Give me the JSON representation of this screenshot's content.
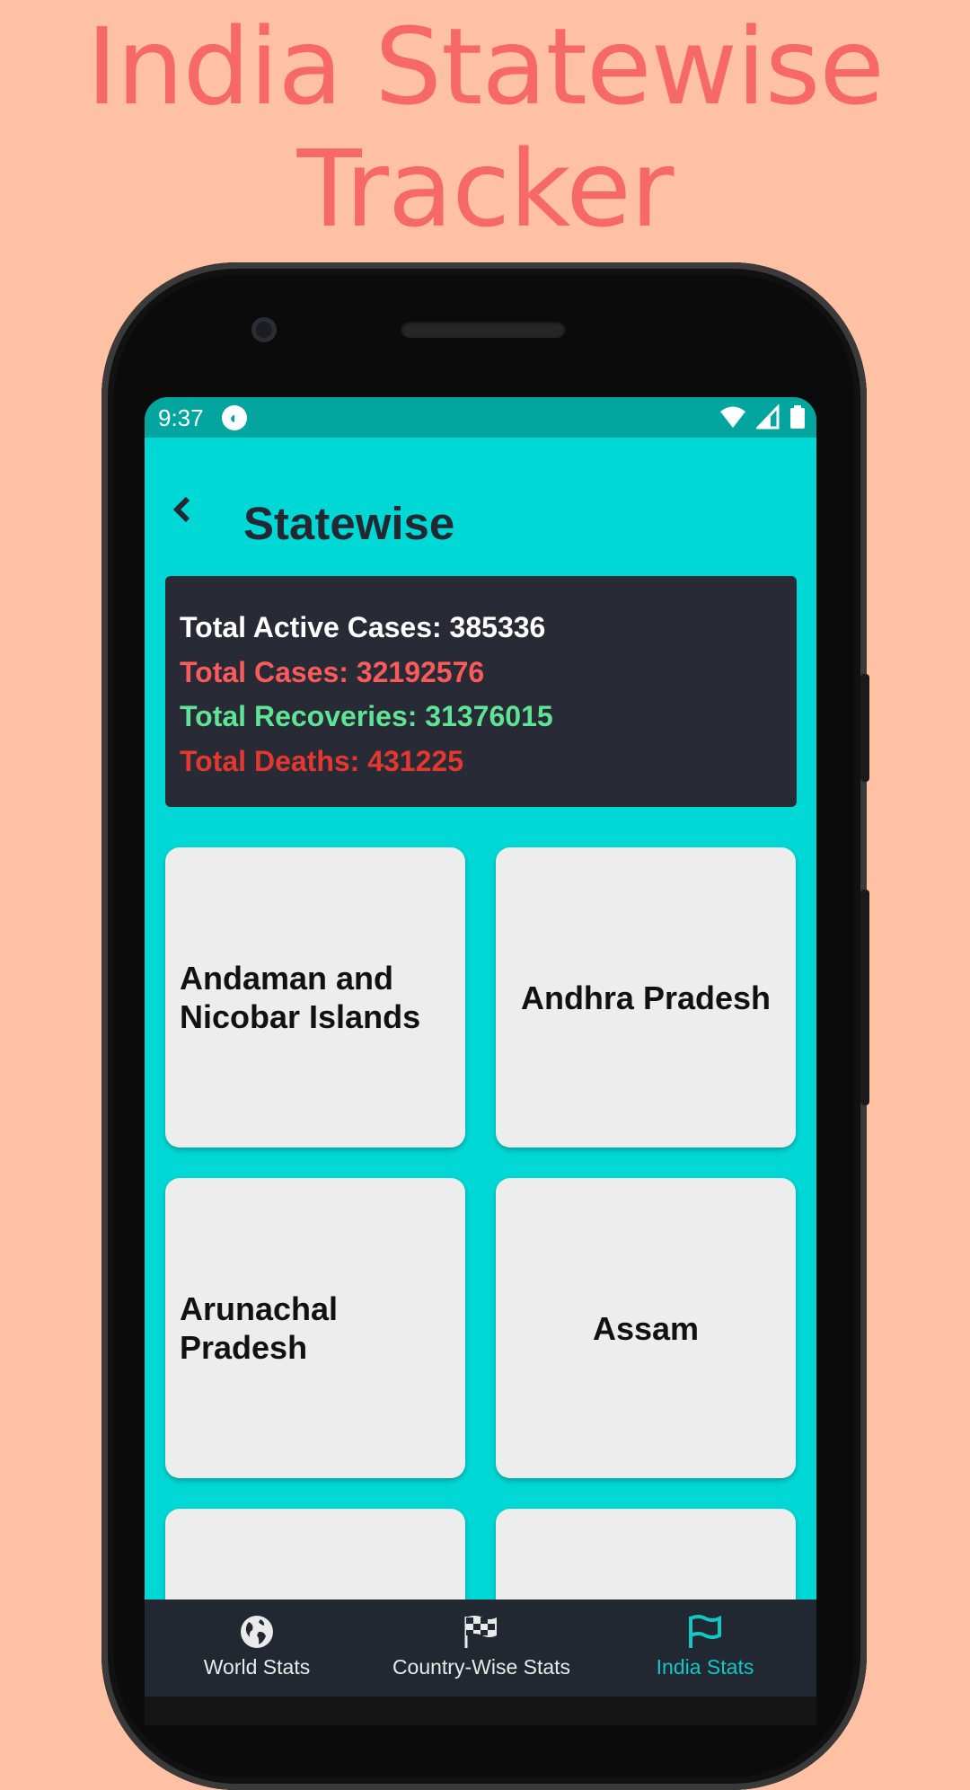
{
  "promo": {
    "title_line1": "India Statewise",
    "title_line2": "Tracker"
  },
  "status_bar": {
    "time": "9:37"
  },
  "app_bar": {
    "title": "Statewise"
  },
  "summary": {
    "active": "Total Active Cases: 385336",
    "cases": "Total Cases: 32192576",
    "recoveries": "Total Recoveries: 31376015",
    "deaths": "Total Deaths: 431225"
  },
  "states": [
    {
      "name": "Andaman and Nicobar Islands"
    },
    {
      "name": "Andhra Pradesh"
    },
    {
      "name": "Arunachal Pradesh"
    },
    {
      "name": "Assam"
    },
    {
      "name": ""
    },
    {
      "name": ""
    }
  ],
  "bottom_nav": {
    "items": [
      {
        "label": "World Stats",
        "icon": "globe-icon",
        "active": false
      },
      {
        "label": "Country-Wise Stats",
        "icon": "checkered-flag-icon",
        "active": false
      },
      {
        "label": "India Stats",
        "icon": "flag-icon",
        "active": true
      }
    ]
  },
  "colors": {
    "background": "#FFC1A4",
    "promo_title": "#F76868",
    "screen": "#00D8D6",
    "status_bar": "#02A69F",
    "dark": "#222831",
    "summary_bg": "#282A36",
    "cases": "#F95B5B",
    "recoveries": "#5FE395",
    "deaths": "#E2382F",
    "nav_active": "#10C8C6"
  }
}
